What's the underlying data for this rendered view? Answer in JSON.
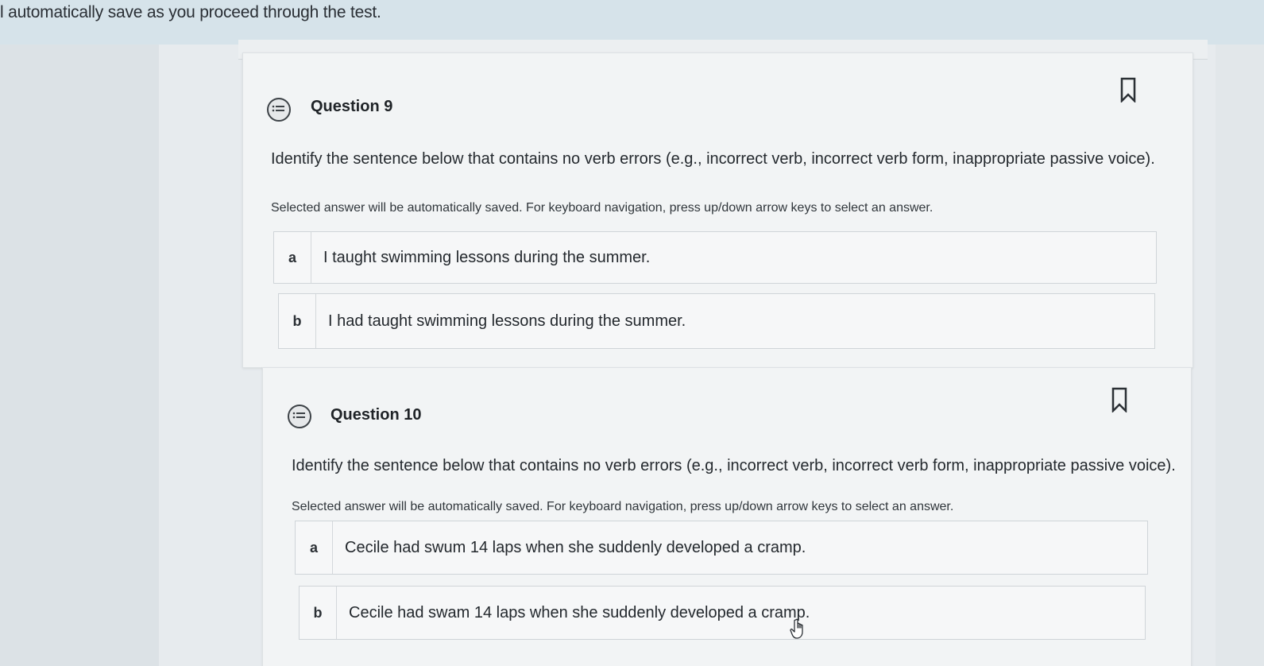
{
  "banner": {
    "text": "l automatically save as you proceed through the test."
  },
  "questions": [
    {
      "title": "Question 9",
      "icon": "question-list-icon",
      "bookmark_icon": "bookmark-icon",
      "prompt": "Identify the sentence below that contains no verb errors (e.g., incorrect verb, incorrect verb form, inappropriate passive voice).",
      "hint": "Selected answer will be automatically saved. For keyboard navigation, press up/down arrow keys to select an answer.",
      "answers": [
        {
          "letter": "a",
          "text": "I taught swimming lessons during the summer."
        },
        {
          "letter": "b",
          "text": "I had taught swimming lessons during the summer."
        }
      ]
    },
    {
      "title": "Question 10",
      "icon": "question-list-icon",
      "bookmark_icon": "bookmark-icon",
      "prompt": "Identify the sentence below that contains no verb errors (e.g., incorrect verb, incorrect verb form, inappropriate passive voice).",
      "hint": "Selected answer will be automatically saved. For keyboard navigation, press up/down arrow keys to select an answer.",
      "answers": [
        {
          "letter": "a",
          "text": "Cecile had swum 14 laps when she suddenly developed a cramp."
        },
        {
          "letter": "b",
          "text": "Cecile had swam 14 laps when she suddenly developed a cramp."
        }
      ]
    }
  ],
  "cursor": {
    "icon": "hand-pointer-icon"
  }
}
